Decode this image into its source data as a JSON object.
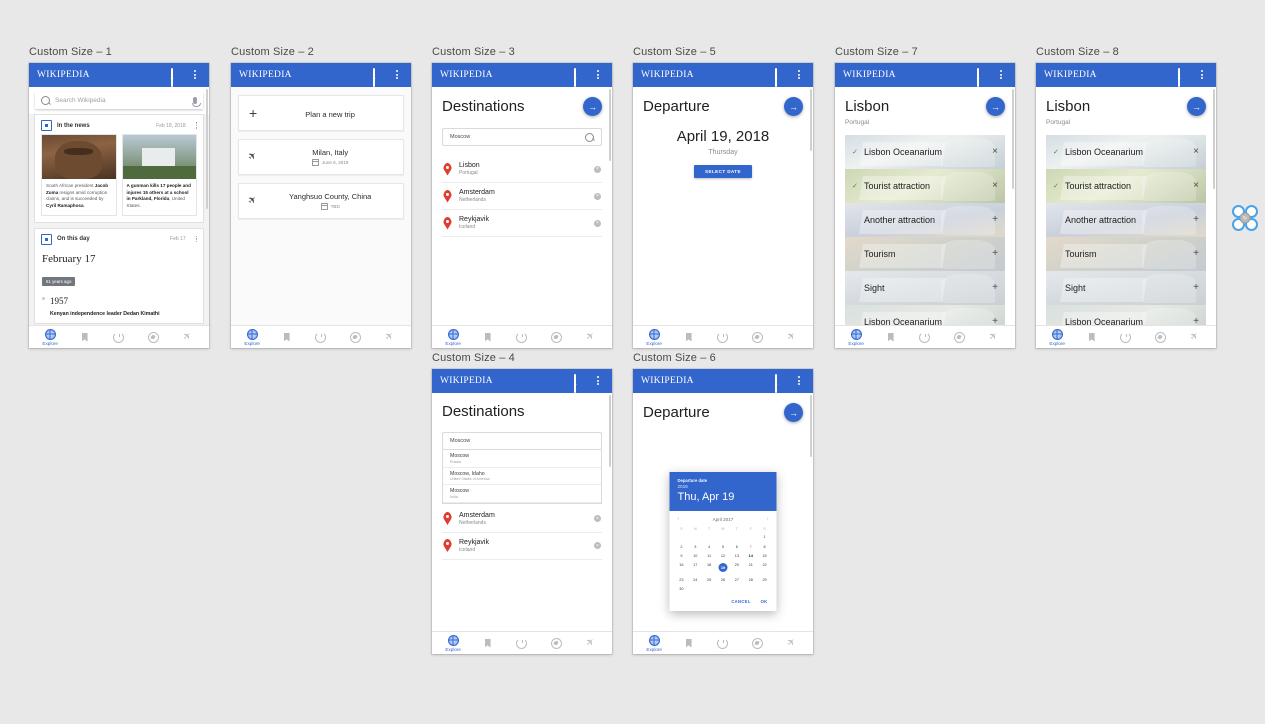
{
  "appbar": {
    "wordmark": "WIKIPEDIA",
    "tab_count": "1",
    "overflow_icon": "more-vertical-icon"
  },
  "bottom_nav": [
    {
      "label": "Explore",
      "icon": "globe-icon",
      "active": true
    },
    {
      "label": "",
      "icon": "bookmark-icon",
      "active": false
    },
    {
      "label": "",
      "icon": "history-icon",
      "active": false
    },
    {
      "label": "",
      "icon": "compass-icon",
      "active": false
    },
    {
      "label": "",
      "icon": "airplane-icon",
      "active": false
    }
  ],
  "frames": [
    {
      "label": "Custom Size – 1"
    },
    {
      "label": "Custom Size – 2"
    },
    {
      "label": "Custom Size – 3"
    },
    {
      "label": "Custom Size – 4"
    },
    {
      "label": "Custom Size – 5"
    },
    {
      "label": "Custom Size – 6"
    },
    {
      "label": "Custom Size – 7"
    },
    {
      "label": "Custom Size – 8"
    }
  ],
  "panel1": {
    "search": {
      "placeholder": "Search Wikipedia",
      "search_icon": "search-icon",
      "mic_icon": "microphone-icon"
    },
    "news_card": {
      "title": "In the news",
      "date": "Feb 18, 2018",
      "items": [
        {
          "lead": "South African president ",
          "bold": "Jacob Zuma",
          "rest": " resigns amid corruption claims, and is succeeded by ",
          "bold2": "Cyril Ramaphosa",
          "tail": "."
        },
        {
          "lead": "A gunman kills 17 people and injures 15 others at a school in ",
          "bold": "Parkland, Florida",
          "rest": ", United States.",
          "bold2": "",
          "tail": ""
        }
      ]
    },
    "onthisday_card": {
      "title": "On this day",
      "date": "Feb 17",
      "heading": "February 17",
      "badge": "61 years ago",
      "year": "1957",
      "entry": "Kenyan independence leader Dedan Kimathi"
    }
  },
  "panel2": {
    "new_trip_label": "Plan a new trip",
    "trips": [
      {
        "name": "Milan, Italy",
        "date": "June 6, 2019"
      },
      {
        "name": "Yanghsuo County, China",
        "date": "TBD"
      }
    ]
  },
  "panel3": {
    "title": "Destinations",
    "fab_icon": "arrow-right-icon",
    "search_value": "Moscow",
    "search_icon": "search-icon",
    "destinations": [
      {
        "city": "Lisbon",
        "country": "Portugal"
      },
      {
        "city": "Amsterdam",
        "country": "Netherlands"
      },
      {
        "city": "Reykjavik",
        "country": "Iceland"
      }
    ]
  },
  "panel4": {
    "title": "Destinations",
    "search_value": "Moscow",
    "suggestions": [
      {
        "name": "Moscow",
        "region": "Russia"
      },
      {
        "name": "Moscow, Idaho",
        "region": "United States of America"
      },
      {
        "name": "Moscow",
        "region": "India"
      }
    ],
    "destinations": [
      {
        "city": "Amsterdam",
        "country": "Netherlands"
      },
      {
        "city": "Reykjavik",
        "country": "Iceland"
      }
    ]
  },
  "panel5": {
    "title": "Departure",
    "fab_icon": "arrow-right-icon",
    "date": "April 19, 2018",
    "weekday": "Thursday",
    "button_label": "SELECT DATE"
  },
  "panel6": {
    "title": "Departure",
    "fab_icon": "arrow-right-icon",
    "dialog": {
      "kicker": "Departure date",
      "year": "2019",
      "day": "Thu, Apr 19",
      "month_label": "April 2017",
      "prev_icon": "chevron-left-icon",
      "next_icon": "chevron-right-icon",
      "dow": [
        "S",
        "M",
        "T",
        "W",
        "T",
        "F",
        "S"
      ],
      "blanks_before": 6,
      "days": [
        1,
        2,
        3,
        4,
        5,
        6,
        7,
        8,
        9,
        10,
        11,
        12,
        13,
        14,
        15,
        16,
        17,
        18,
        19,
        20,
        21,
        22,
        23,
        24,
        25,
        26,
        27,
        28,
        29,
        30
      ],
      "selected_day": 19,
      "red_day": 7,
      "bold_day": 14,
      "cancel_label": "CANCEL",
      "ok_label": "OK"
    }
  },
  "panel7": {
    "title": "Lisbon",
    "subtitle": "Portugal",
    "fab_icon": "arrow-right-icon",
    "attractions": [
      {
        "name": "Lisbon Oceanarium",
        "checked": true,
        "action": "×",
        "action_icon": "close-icon"
      },
      {
        "name": "Tourist attraction",
        "checked": true,
        "action": "×",
        "action_icon": "close-icon"
      },
      {
        "name": "Another attraction",
        "checked": false,
        "action": "+",
        "action_icon": "plus-icon"
      },
      {
        "name": "Tourism",
        "checked": false,
        "action": "+",
        "action_icon": "plus-icon"
      },
      {
        "name": "Sight",
        "checked": false,
        "action": "+",
        "action_icon": "plus-icon"
      },
      {
        "name": "Lisbon Oceanarium",
        "checked": false,
        "action": "+",
        "action_icon": "plus-icon"
      }
    ]
  },
  "panel8": {
    "title": "Lisbon",
    "subtitle": "Portugal",
    "fab_icon": "arrow-right-icon",
    "attractions": [
      {
        "name": "Lisbon Oceanarium",
        "checked": true,
        "action": "×",
        "action_icon": "close-icon"
      },
      {
        "name": "Tourist attraction",
        "checked": true,
        "action": "×",
        "action_icon": "close-icon"
      },
      {
        "name": "Another attraction",
        "checked": false,
        "action": "+",
        "action_icon": "plus-icon"
      },
      {
        "name": "Tourism",
        "checked": false,
        "action": "+",
        "action_icon": "plus-icon"
      },
      {
        "name": "Sight",
        "checked": false,
        "action": "+",
        "action_icon": "plus-icon"
      },
      {
        "name": "Lisbon Oceanarium",
        "checked": false,
        "action": "+",
        "action_icon": "plus-icon"
      }
    ]
  },
  "selection_handle": {
    "hub_icon": "rotate-icon"
  }
}
